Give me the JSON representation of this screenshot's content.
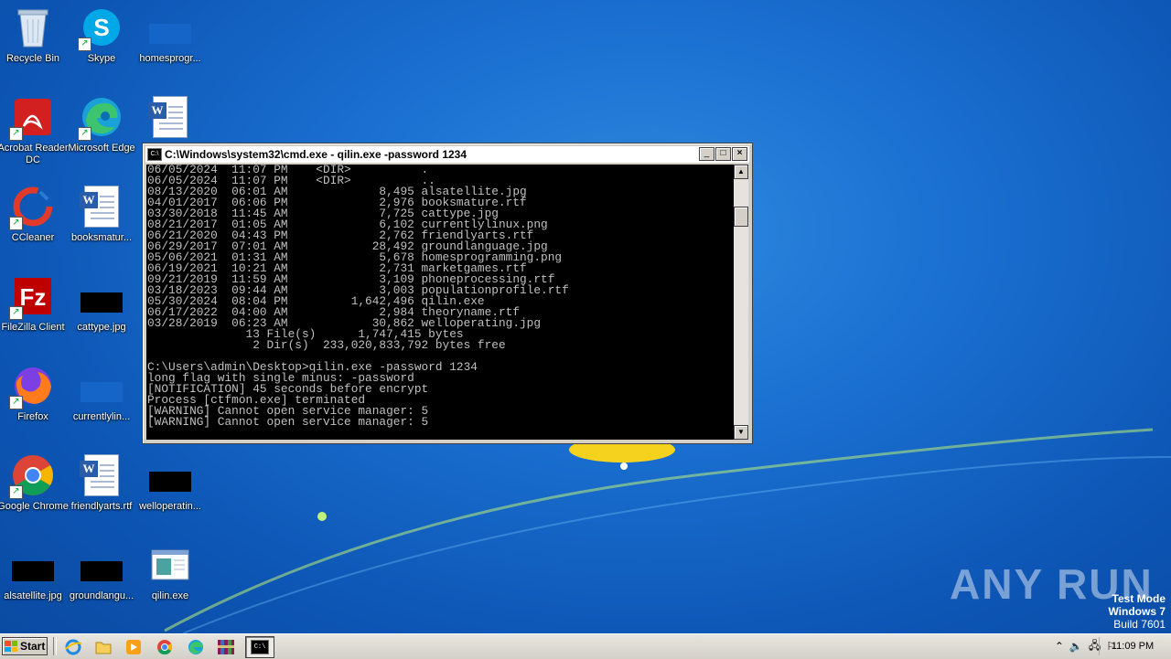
{
  "desktop": {
    "icons": [
      {
        "label": "Recycle Bin",
        "icon": "recycle-bin-icon"
      },
      {
        "label": "Skype",
        "icon": "skype-icon"
      },
      {
        "label": "homesprogr...",
        "icon": "image-file-icon"
      },
      {
        "label": "Acrobat Reader DC",
        "icon": "acrobat-icon"
      },
      {
        "label": "Microsoft Edge",
        "icon": "edge-icon"
      },
      {
        "label": "",
        "icon": "word-document-icon"
      },
      {
        "label": "CCleaner",
        "icon": "ccleaner-icon"
      },
      {
        "label": "booksmatur...",
        "icon": "word-document-icon"
      },
      {
        "label": "FileZilla Client",
        "icon": "filezilla-icon"
      },
      {
        "label": "cattype.jpg",
        "icon": "image-file-icon"
      },
      {
        "label": "Firefox",
        "icon": "firefox-icon"
      },
      {
        "label": "currentlylin...",
        "icon": "image-file-icon"
      },
      {
        "label": "Google Chrome",
        "icon": "chrome-icon"
      },
      {
        "label": "friendlyarts.rtf",
        "icon": "word-document-icon"
      },
      {
        "label": "welloperatin...",
        "icon": "image-file-icon"
      },
      {
        "label": "alsatellite.jpg",
        "icon": "image-file-icon"
      },
      {
        "label": "groundlangu...",
        "icon": "image-file-icon"
      },
      {
        "label": "qilin.exe",
        "icon": "executable-icon"
      }
    ]
  },
  "cmd_window": {
    "title": "C:\\Windows\\system32\\cmd.exe - qilin.exe  -password 1234",
    "lines": [
      "06/05/2024  11:07 PM    <DIR>          .",
      "06/05/2024  11:07 PM    <DIR>          ..",
      "08/13/2020  06:01 AM             8,495 alsatellite.jpg",
      "04/01/2017  06:06 PM             2,976 booksmature.rtf",
      "03/30/2018  11:45 AM             7,725 cattype.jpg",
      "08/21/2017  01:05 AM             6,102 currentlylinux.png",
      "06/21/2020  04:43 PM             2,762 friendlyarts.rtf",
      "06/29/2017  07:01 AM            28,492 groundlanguage.jpg",
      "05/06/2021  01:31 AM             5,678 homesprogramming.png",
      "06/19/2021  10:21 AM             2,731 marketgames.rtf",
      "09/21/2019  11:59 AM             3,109 phoneprocessing.rtf",
      "03/18/2023  09:44 AM             3,003 populationprofile.rtf",
      "05/30/2024  08:04 PM         1,642,496 qilin.exe",
      "06/17/2022  04:00 AM             2,984 theoryname.rtf",
      "03/28/2019  06:23 AM            30,862 welloperating.jpg",
      "              13 File(s)      1,747,415 bytes",
      "               2 Dir(s)  233,020,833,792 bytes free",
      "",
      "C:\\Users\\admin\\Desktop>qilin.exe -password 1234",
      "long flag with single minus: -password",
      "[NOTIFICATION] 45 seconds before encrypt",
      "Process [ctfmon.exe] terminated",
      "[WARNING] Cannot open service manager: 5",
      "[WARNING] Cannot open service manager: 5"
    ]
  },
  "watermark": {
    "brand": "ANY RUN",
    "mode": "Test Mode",
    "os": "Windows 7",
    "build": "Build 7601"
  },
  "taskbar": {
    "start_label": "Start",
    "clock": "11:09 PM",
    "apps": [
      "internet-explorer-icon",
      "folder-icon",
      "media-player-icon",
      "chrome-icon",
      "edge-icon",
      "winrar-icon",
      "cmd-icon"
    ]
  }
}
